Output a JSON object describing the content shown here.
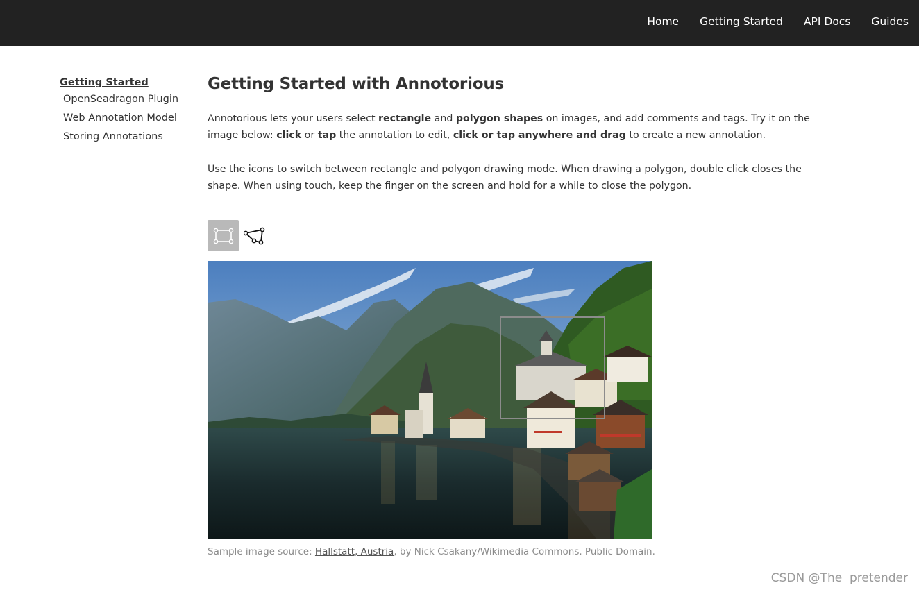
{
  "nav": {
    "links": [
      "Home",
      "Getting Started",
      "API Docs",
      "Guides"
    ]
  },
  "sidebar": {
    "heading": "Getting Started",
    "items": [
      "OpenSeadragon Plugin",
      "Web Annotation Model",
      "Storing Annotations"
    ]
  },
  "main": {
    "title": "Getting Started with Annotorious",
    "para1": {
      "t1": "Annotorious lets your users select ",
      "b1": "rectangle",
      "t2": " and ",
      "b2": "polygon shapes",
      "t3": " on images, and add comments and tags. Try it on the image below: ",
      "b3": "click",
      "t4": " or ",
      "b4": "tap",
      "t5": " the annotation to edit, ",
      "b5": "click or tap anywhere and drag",
      "t6": " to create a new annotation."
    },
    "para2": "Use the icons to switch between rectangle and polygon drawing mode. When drawing a polygon, double click closes the shape. When using touch, keep the finger on the screen and hold for a while to close the polygon."
  },
  "tools": {
    "rect_icon": "rectangle-tool-icon",
    "polygon_icon": "polygon-tool-icon",
    "active": "rectangle"
  },
  "image": {
    "subject": "Hallstatt lakeside village with mountains",
    "annotation_selected": true
  },
  "caption": {
    "prefix": "Sample image source: ",
    "link": "Hallstatt, Austria",
    "suffix": ", by Nick Csakany/Wikimedia Commons. Public Domain."
  },
  "watermark": "CSDN @The  pretender",
  "colors": {
    "topbar": "#222222",
    "text": "#333333",
    "active_tool": "#b9b9b9",
    "annotation_border": "#8c8c8c"
  }
}
